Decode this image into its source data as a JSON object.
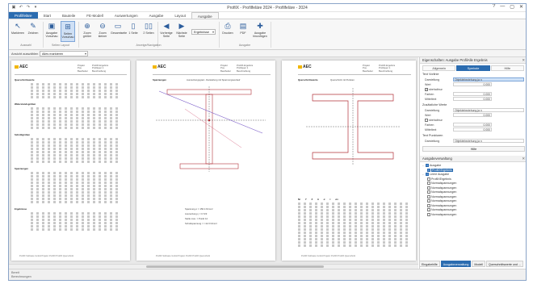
{
  "window": {
    "title": "ProfilX - Profilfeläre 2024 - Profilfeläre - 2024",
    "quick_access": [
      "▣",
      "↶",
      "↷",
      "▾"
    ],
    "controls": [
      "?",
      "—",
      "▢",
      "✕"
    ]
  },
  "menu": {
    "tabs": [
      "Profilfeläre",
      "Start",
      "Bauteile",
      "FE-Modell",
      "Auswertungen",
      "Ausgabe",
      "Layout",
      "Ausgabe"
    ],
    "active_index": 7
  },
  "ribbon": {
    "buttons": [
      {
        "label": "Markieren",
        "icon": "↖"
      },
      {
        "label": "Zeichen",
        "icon": "✎"
      },
      {
        "label": "Ausgabe Vorschau",
        "icon": "▣"
      },
      {
        "label": "Seiten Vorschau",
        "icon": "⊞"
      },
      {
        "label": "Zoom größer",
        "icon": "⊕"
      },
      {
        "label": "Zoom kleiner",
        "icon": "⊖"
      },
      {
        "label": "Gesamtseite",
        "icon": "▭"
      },
      {
        "label": "1 Seite",
        "icon": "▯"
      },
      {
        "label": "2 Seiten",
        "icon": "▯▯"
      },
      {
        "label": "Vorherige Seite",
        "icon": "◀"
      },
      {
        "label": "Nächste Seite",
        "icon": "▶"
      },
      {
        "label": "Drucken",
        "icon": "⎙"
      },
      {
        "label": "PDF",
        "icon": "▤"
      },
      {
        "label": "Ausgabe hinzufügen",
        "icon": "✚"
      }
    ],
    "groups": [
      "Auswahl",
      "Seiten Layout",
      "Anzeige/Navigation",
      "Ausgabe"
    ],
    "combo_value": "Ergebnisse"
  },
  "subbar": {
    "label": "Ansicht auswählen",
    "combo_value": "Alles markieren"
  },
  "pages": [
    {
      "logo": "AEC",
      "header_lines": [
        "Projekt",
        "Pos.",
        "Bearbeiter"
      ],
      "header_values": [
        "ProfilX-Ergebnis",
        "Profilquer 1",
        "Beschreibung"
      ],
      "section_titles": [
        "Querschnittswerte",
        "Widerstandsgrößen",
        "Schnittgrößen",
        "Spannungen",
        "Ergebnisse"
      ],
      "footer": "ProfilX Software GmbH     Projekt: ProfilX     ProfilX Querschnitt"
    },
    {
      "logo": "AEC",
      "title_left": "Spannungen",
      "title_right": "Ausnutzungsgrad - Darstellung mit Spannungsverlauf",
      "result_lines": [
        "Spannung σ = 156.4 N/mm²",
        "Ausnutzung η = 0.723",
        "Stelle max. = Punkt 12",
        "Schubspannung τ = 42.3 N/mm²"
      ],
      "footer": "ProfilX Software GmbH     Projekt: ProfilX     ProfilX Querschnitt"
    },
    {
      "logo": "AEC",
      "title_left": "Querschnittswerte",
      "title_right": "Querschnitt mit Punkten",
      "table_headers": [
        "Nr",
        "Y",
        "Z",
        "A",
        "σ",
        "τ",
        "σv"
      ],
      "footer": "ProfilX Software GmbH     Projekt: ProfilX     ProfilX Querschnitt"
    }
  ],
  "properties_panel": {
    "title": "Eigenschaften: Ausgabe ProfilAlle Ergebnis",
    "tabs": [
      "Allgemein",
      "Symbole",
      "Hilfe"
    ],
    "active_tab": 1,
    "section1": "Text Vorlinie",
    "rows1": [
      {
        "key": "Darstellung",
        "value": "Objektebeziehung ja n"
      },
      {
        "key": "Wert",
        "value": "0.000"
      },
      {
        "key": "sbehaltnur",
        "value": ""
      },
      {
        "key": "Farben",
        "value": "0.000"
      },
      {
        "key": "Mitteltext",
        "value": "0.000"
      }
    ],
    "section2": "Zusätzliche Werte",
    "rows2": [
      {
        "key": "Darstellung",
        "value": "Objektebeziehung ja n"
      },
      {
        "key": "Wert",
        "value": "0.000"
      },
      {
        "key": "sbehaltnur",
        "value": ""
      },
      {
        "key": "Farben",
        "value": "0.000"
      },
      {
        "key": "Mitteltext",
        "value": "0.000"
      }
    ],
    "section3": "Text Punkturen",
    "rows3": [
      {
        "key": "Darstellung",
        "value": "Objektebeziehung ja n"
      }
    ],
    "help_button": "Hilfe"
  },
  "output_panel": {
    "title": "Ausgabeverwaltung",
    "nodes": [
      {
        "label": "Ausgabe",
        "level": 0,
        "toggle": "−",
        "blue": true,
        "selected": false
      },
      {
        "label": "ProfilXErgebnis",
        "level": 1,
        "toggle": "",
        "blue": true,
        "selected": true
      },
      {
        "label": "Leere Ausgabe",
        "level": 0,
        "toggle": "−",
        "blue": true,
        "selected": false
      },
      {
        "label": "ProfilXErgebnis",
        "level": 1,
        "toggle": "",
        "blue": false,
        "selected": false
      },
      {
        "label": "Normalspannungen",
        "level": 1,
        "toggle": "",
        "blue": false,
        "selected": false
      },
      {
        "label": "Normalspannungen",
        "level": 1,
        "toggle": "",
        "blue": false,
        "selected": false
      },
      {
        "label": "Normalspannungen",
        "level": 1,
        "toggle": "",
        "blue": false,
        "selected": false
      },
      {
        "label": "Normalspannungen",
        "level": 1,
        "toggle": "",
        "blue": false,
        "selected": false
      },
      {
        "label": "Normalspannungen",
        "level": 1,
        "toggle": "",
        "blue": false,
        "selected": false
      },
      {
        "label": "Normalspannungen",
        "level": 1,
        "toggle": "",
        "blue": false,
        "selected": false
      },
      {
        "label": "Normalspannungen",
        "level": 1,
        "toggle": "",
        "blue": false,
        "selected": false
      },
      {
        "label": "Normalspannungen",
        "level": 1,
        "toggle": "",
        "blue": false,
        "selected": false
      }
    ]
  },
  "bottom_tabs": [
    "Eingabehilfe",
    "Ausgabeverwaltung",
    "Modell",
    "Querschnittswerte und ..."
  ],
  "bottom_tab_active": 1,
  "status": {
    "line1": "Bereit",
    "line2": "Berechnungen"
  },
  "colors": {
    "accent": "#2b6cb0",
    "logo_yellow": "#f2b600",
    "stress_line": "#7a5cc8",
    "section_red": "#b3323a"
  }
}
